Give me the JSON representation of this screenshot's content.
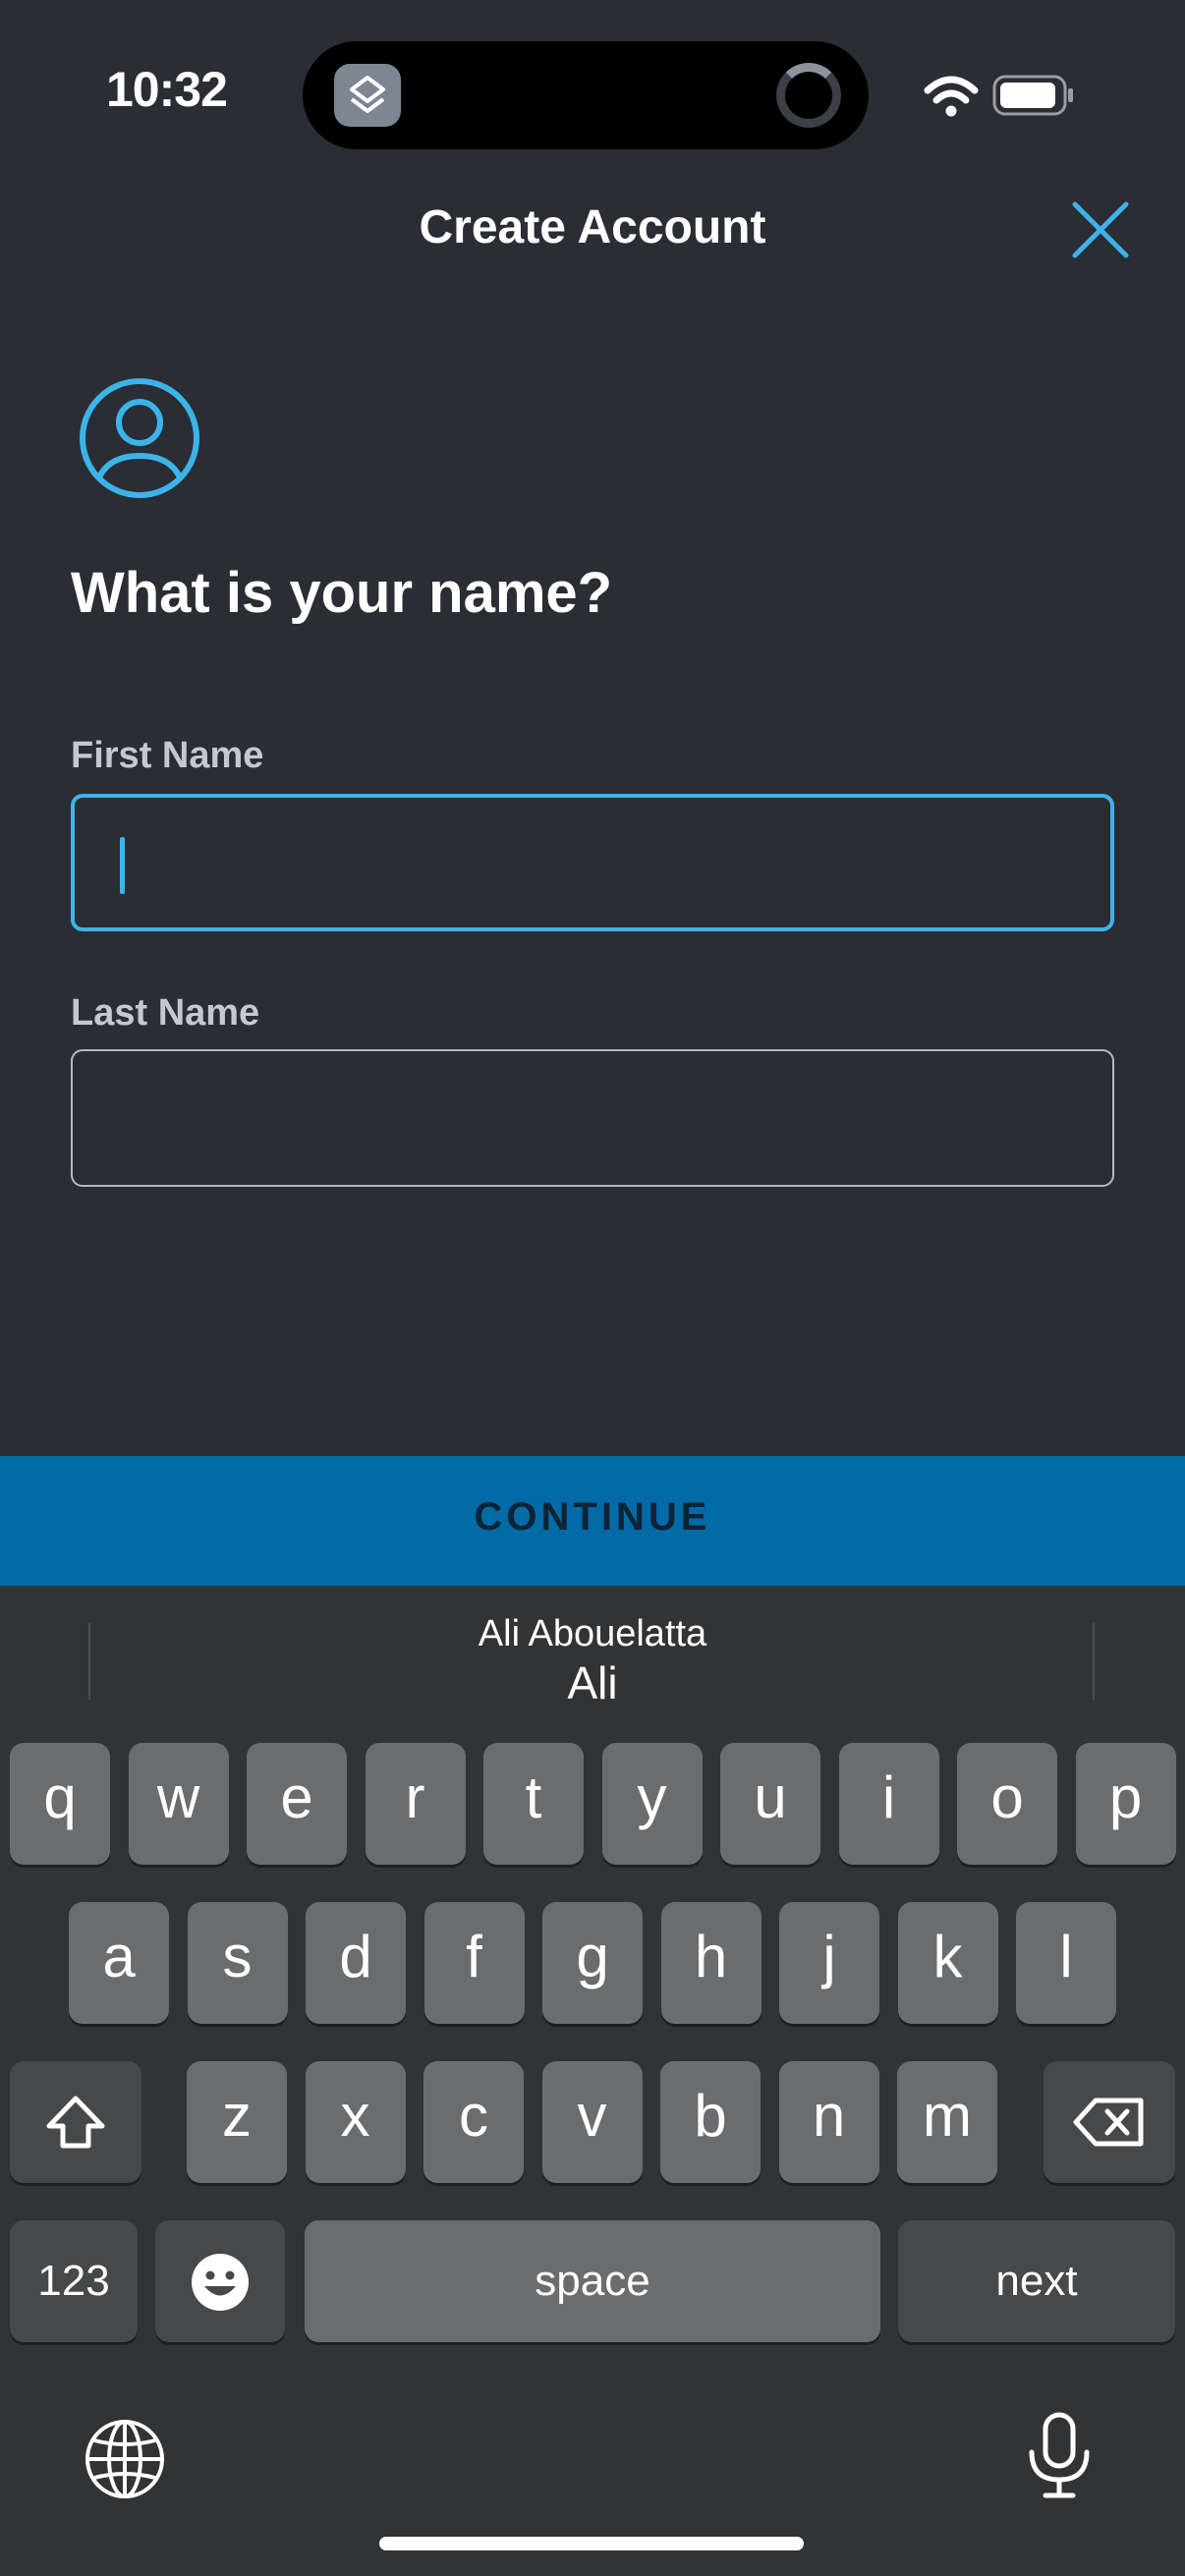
{
  "status_bar": {
    "time": "10:32"
  },
  "header": {
    "title": "Create Account"
  },
  "form": {
    "question": "What is your name?",
    "first_name_label": "First Name",
    "first_name_value": "",
    "last_name_label": "Last Name",
    "last_name_value": ""
  },
  "continue_label": "CONTINUE",
  "keyboard": {
    "suggestion_top": "Ali Abouelatta",
    "suggestion_main": "Ali",
    "row1": [
      "q",
      "w",
      "e",
      "r",
      "t",
      "y",
      "u",
      "i",
      "o",
      "p"
    ],
    "row2": [
      "a",
      "s",
      "d",
      "f",
      "g",
      "h",
      "j",
      "k",
      "l"
    ],
    "row3": [
      "z",
      "x",
      "c",
      "v",
      "b",
      "n",
      "m"
    ],
    "numbers_key": "123",
    "space_key": "space",
    "return_key": "next"
  },
  "colors": {
    "background": "#2a2d33",
    "accent": "#3cb4ea",
    "button": "#006ba6"
  }
}
